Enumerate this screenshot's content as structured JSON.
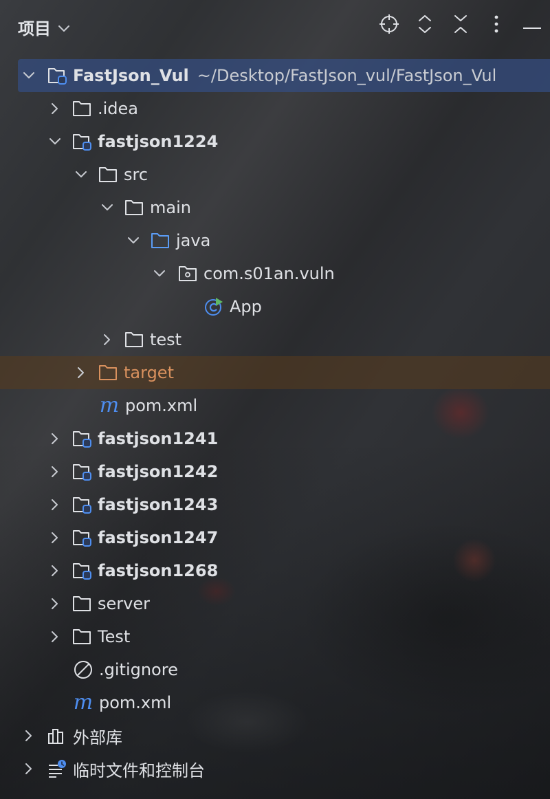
{
  "header": {
    "title": "项目",
    "actions": [
      "locate-icon",
      "expand-collapse-icon",
      "collapse-all-icon",
      "more-icon",
      "minimize-icon"
    ]
  },
  "tree": {
    "root": {
      "name": "FastJson_Vul",
      "path": "~/Desktop/FastJson_vul/FastJson_Vul"
    },
    "idea": ".idea",
    "m1224": "fastjson1224",
    "src": "src",
    "main": "main",
    "java": "java",
    "pkg": "com.s01an.vuln",
    "app": "App",
    "test": "test",
    "target": "target",
    "pom_inner": "pom.xml",
    "m1241": "fastjson1241",
    "m1242": "fastjson1242",
    "m1243": "fastjson1243",
    "m1247": "fastjson1247",
    "m1268": "fastjson1268",
    "server": "server",
    "Test": "Test",
    "gitignore": ".gitignore",
    "pom_root": "pom.xml",
    "external_libs": "外部库",
    "scratches": "临时文件和控制台"
  },
  "colors": {
    "selection": "#344e82",
    "target_highlight": "#5a3c1e",
    "target_text": "#d9915e",
    "module_badge": "#4e8ef0",
    "java_folder": "#5b9cf5"
  }
}
